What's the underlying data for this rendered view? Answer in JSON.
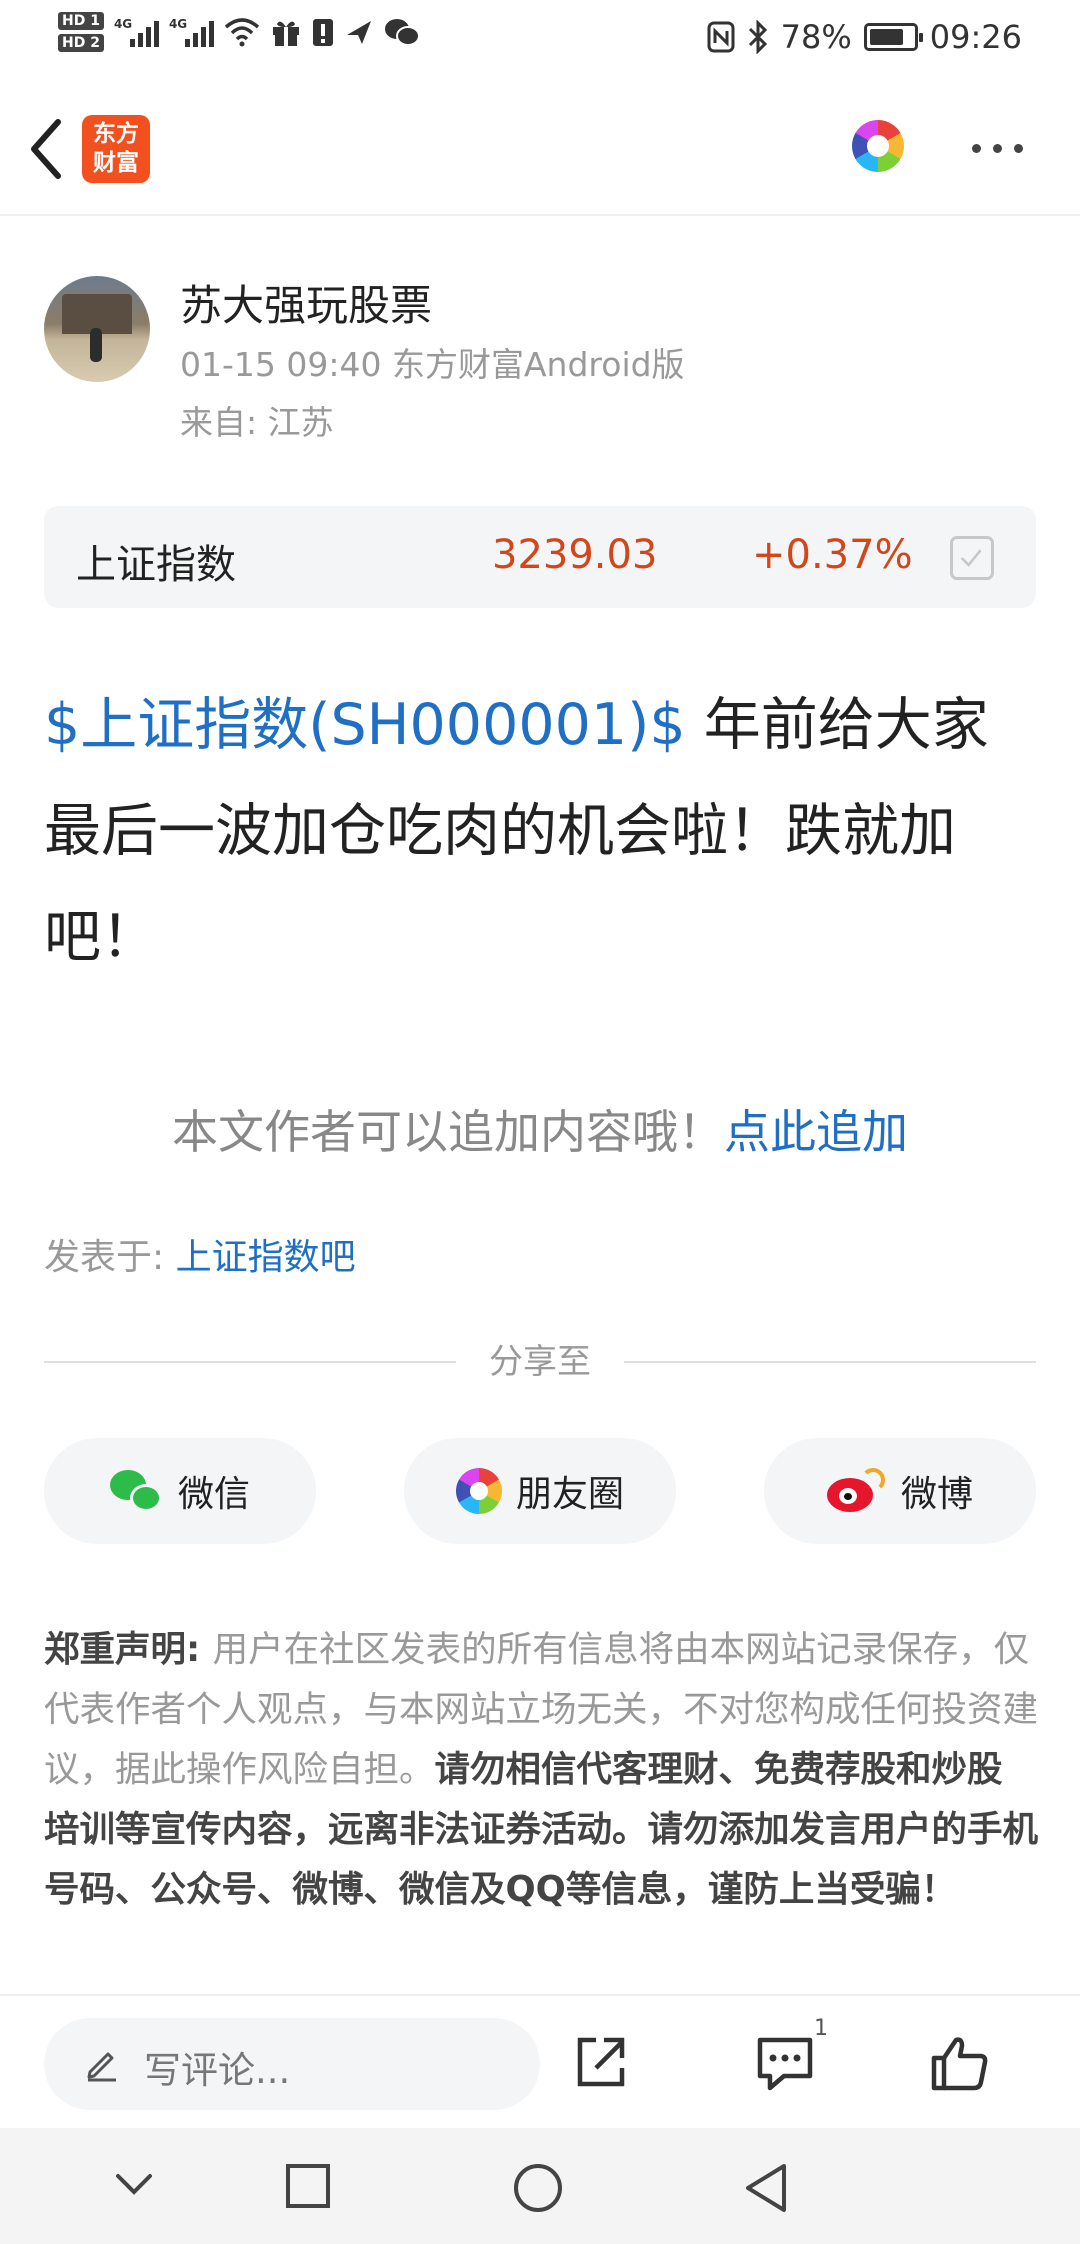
{
  "status_bar": {
    "hd1": "HD 1",
    "hd2": "HD 2",
    "net1": "4G",
    "net2": "4G",
    "battery_percent": "78%",
    "battery_level": 0.78,
    "time": "09:26"
  },
  "header": {
    "logo_line1": "东方",
    "logo_line2": "财富",
    "back_icon": "chevron-left-icon",
    "more_icon": "more-dots-icon"
  },
  "author": {
    "name": "苏大强玩股票",
    "meta": "01-15 09:40 东方财富Android版",
    "location": "来自: 江苏"
  },
  "stock": {
    "name": "上证指数",
    "price": "3239.03",
    "change": "+0.37%",
    "color": "#d1461a"
  },
  "post": {
    "tag": "$上证指数(SH000001)$",
    "text": " 年前给大家最后一波加仓吃肉的机会啦！跌就加吧！"
  },
  "append": {
    "prompt": "本文作者可以追加内容哦！",
    "link": "点此追加"
  },
  "posted_in": {
    "label": "发表于: ",
    "forum": "上证指数吧"
  },
  "share": {
    "title": "分享至",
    "wechat": "微信",
    "moments": "朋友圈",
    "weibo": "微博"
  },
  "disclaimer": {
    "label": "郑重声明: ",
    "text": "用户在社区发表的所有信息将由本网站记录保存，仅代表作者个人观点，与本网站立场无关，不对您构成任何投资建议，据此操作风险自担。",
    "warning": "请勿相信代客理财、免费荐股和炒股培训等宣传内容，远离非法证券活动。请勿添加发言用户的手机号码、公众号、微博、微信及QQ等信息，谨防上当受骗！"
  },
  "action_bar": {
    "comment_placeholder": "写评论...",
    "comment_count": "1"
  },
  "colors": {
    "link": "#1f6fc4",
    "brand": "#f2501f"
  }
}
